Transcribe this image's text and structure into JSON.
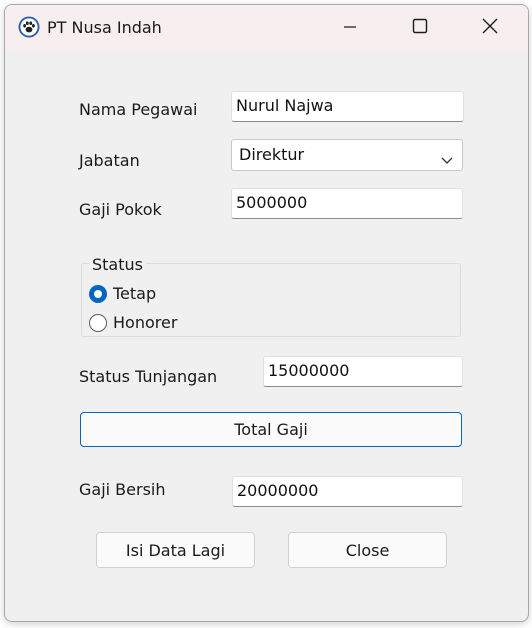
{
  "window": {
    "title": "PT Nusa Indah",
    "icon": "paw-icon",
    "controls": [
      "minimize-icon",
      "maximize-icon",
      "close-icon"
    ]
  },
  "form": {
    "nama_label": "Nama Pegawai",
    "nama_value": "Nurul Najwa",
    "jabatan_label": "Jabatan",
    "jabatan_value": "Direktur",
    "gaji_pokok_label": "Gaji Pokok",
    "gaji_pokok_value": "5000000",
    "status_group_title": "Status",
    "status_options": [
      {
        "label": "Tetap",
        "selected": true
      },
      {
        "label": "Honorer",
        "selected": false
      }
    ],
    "tunjangan_label": "Status Tunjangan",
    "tunjangan_value": "15000000",
    "total_button_label": "Total Gaji",
    "gaji_bersih_label": "Gaji Bersih",
    "gaji_bersih_value": "20000000",
    "reset_button_label": "Isi Data Lagi",
    "close_button_label": "Close"
  },
  "colors": {
    "accent": "#0067c0",
    "titlebar": "#f7efef",
    "window_bg": "#f0f0f0"
  }
}
